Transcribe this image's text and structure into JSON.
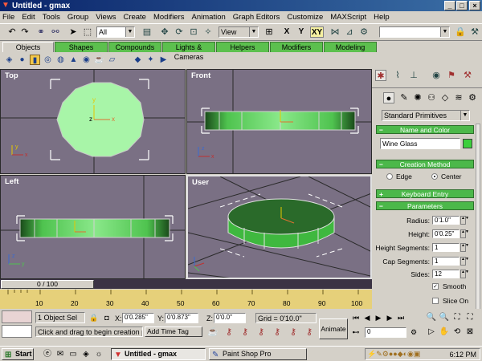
{
  "window": {
    "title": "Untitled - gmax",
    "title_icon": "gmax-logo-icon"
  },
  "menu": [
    "File",
    "Edit",
    "Tools",
    "Group",
    "Views",
    "Create",
    "Modifiers",
    "Animation",
    "Graph Editors",
    "Customize",
    "MAXScript",
    "Help"
  ],
  "toolbar": {
    "selection_filter": "All",
    "ref_coord": "View",
    "axis_label_x": "X",
    "axis_label_y": "Y",
    "axis_label_xy": "XY",
    "named_selection": ""
  },
  "tabs": [
    "Objects",
    "Shapes",
    "Compounds",
    "Lights & Cameras",
    "Helpers",
    "Modifiers",
    "Modeling"
  ],
  "viewports": {
    "top": "Top",
    "front": "Front",
    "left": "Left",
    "user": "User"
  },
  "command_panel": {
    "category": "Standard Primitives",
    "name_color_header": "Name and Color",
    "object_name": "Wine Glass",
    "object_color": "#3ccf3c",
    "creation_method_header": "Creation Method",
    "edge_label": "Edge",
    "center_label": "Center",
    "creation_method_selected": "Center",
    "keyboard_entry_header": "Keyboard Entry",
    "parameters_header": "Parameters",
    "radius_label": "Radius:",
    "radius_value": "0'1.0\"",
    "height_label": "Height:",
    "height_value": "0'0.25\"",
    "height_segments_label": "Height Segments:",
    "height_segments_value": "1",
    "cap_segments_label": "Cap Segments:",
    "cap_segments_value": "1",
    "sides_label": "Sides:",
    "sides_value": "12",
    "smooth_label": "Smooth",
    "smooth_checked": true,
    "slice_on_label": "Slice On",
    "slice_on_checked": false
  },
  "timeline": {
    "slider": "0 / 100",
    "ticks": [
      "10",
      "20",
      "30",
      "40",
      "50",
      "60",
      "70",
      "80",
      "90",
      "100"
    ]
  },
  "status": {
    "selection": "1 Object Sel",
    "x_label": "X:",
    "x_value": "0'0.285\"",
    "y_label": "Y:",
    "y_value": "0'0.873\"",
    "z_label": "Z:",
    "z_value": "0'0.0\"",
    "grid": "Grid = 0'10.0\"",
    "prompt": "Click and drag to begin creation proc",
    "add_time_tag": "Add Time Tag",
    "animate": "Animate",
    "frame": "0"
  },
  "taskbar": {
    "start": "Start",
    "tasks": [
      "Untitled - gmax",
      "Paint Shop Pro"
    ],
    "clock": "6:12 PM"
  },
  "colors": {
    "object_green": "#3ccf3c",
    "viewport_bg": "#7a7084",
    "tab_green": "#5cc04e",
    "trackbar": "#e6d07a"
  }
}
